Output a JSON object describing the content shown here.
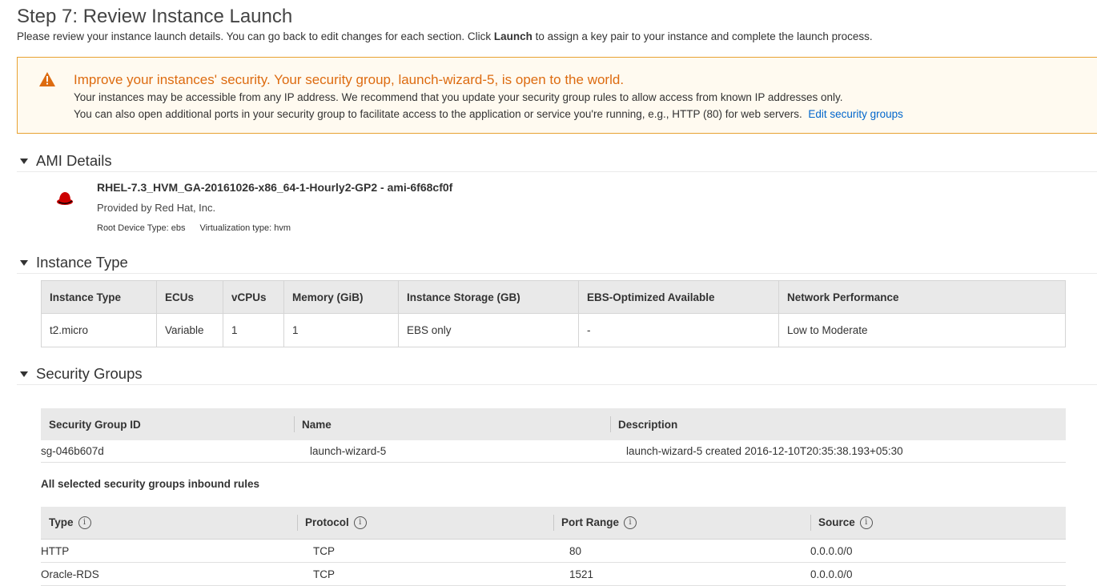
{
  "header": {
    "title": "Step 7: Review Instance Launch",
    "subtitle_pre": "Please review your instance launch details. You can go back to edit changes for each section. Click ",
    "subtitle_bold": "Launch",
    "subtitle_post": " to assign a key pair to your instance and complete the launch process."
  },
  "warning": {
    "icon": "warning-triangle-icon",
    "title": "Improve your instances' security. Your security group, launch-wizard-5, is open to the world.",
    "line1": "Your instances may be accessible from any IP address. We recommend that you update your security group rules to allow access from known IP addresses only.",
    "line2": "You can also open additional ports in your security group to facilitate access to the application or service you're running, e.g., HTTP (80) for web servers.",
    "link": "Edit security groups",
    "color": "#dd6b10"
  },
  "ami": {
    "section_label": "AMI Details",
    "name": "RHEL-7.3_HVM_GA-20161026-x86_64-1-Hourly2-GP2 - ami-6f68cf0f",
    "provider": "Provided by Red Hat, Inc.",
    "root_device": "Root Device Type: ebs",
    "virtualization": "Virtualization type: hvm",
    "logo": "red-hat-logo-icon"
  },
  "instance_type": {
    "section_label": "Instance Type",
    "columns": [
      "Instance Type",
      "ECUs",
      "vCPUs",
      "Memory (GiB)",
      "Instance Storage (GB)",
      "EBS-Optimized Available",
      "Network Performance"
    ],
    "row": [
      "t2.micro",
      "Variable",
      "1",
      "1",
      "EBS only",
      "-",
      "Low to Moderate"
    ]
  },
  "security_groups": {
    "section_label": "Security Groups",
    "columns": [
      "Security Group ID",
      "Name",
      "Description"
    ],
    "row": [
      "sg-046b607d",
      "launch-wizard-5",
      "launch-wizard-5 created 2016-12-10T20:35:38.193+05:30"
    ],
    "inbound_title": "All selected security groups inbound rules",
    "rule_columns": [
      "Type",
      "Protocol",
      "Port Range",
      "Source"
    ],
    "rules": [
      [
        "HTTP",
        "TCP",
        "80",
        "0.0.0.0/0"
      ],
      [
        "Oracle-RDS",
        "TCP",
        "1521",
        "0.0.0.0/0"
      ]
    ]
  }
}
